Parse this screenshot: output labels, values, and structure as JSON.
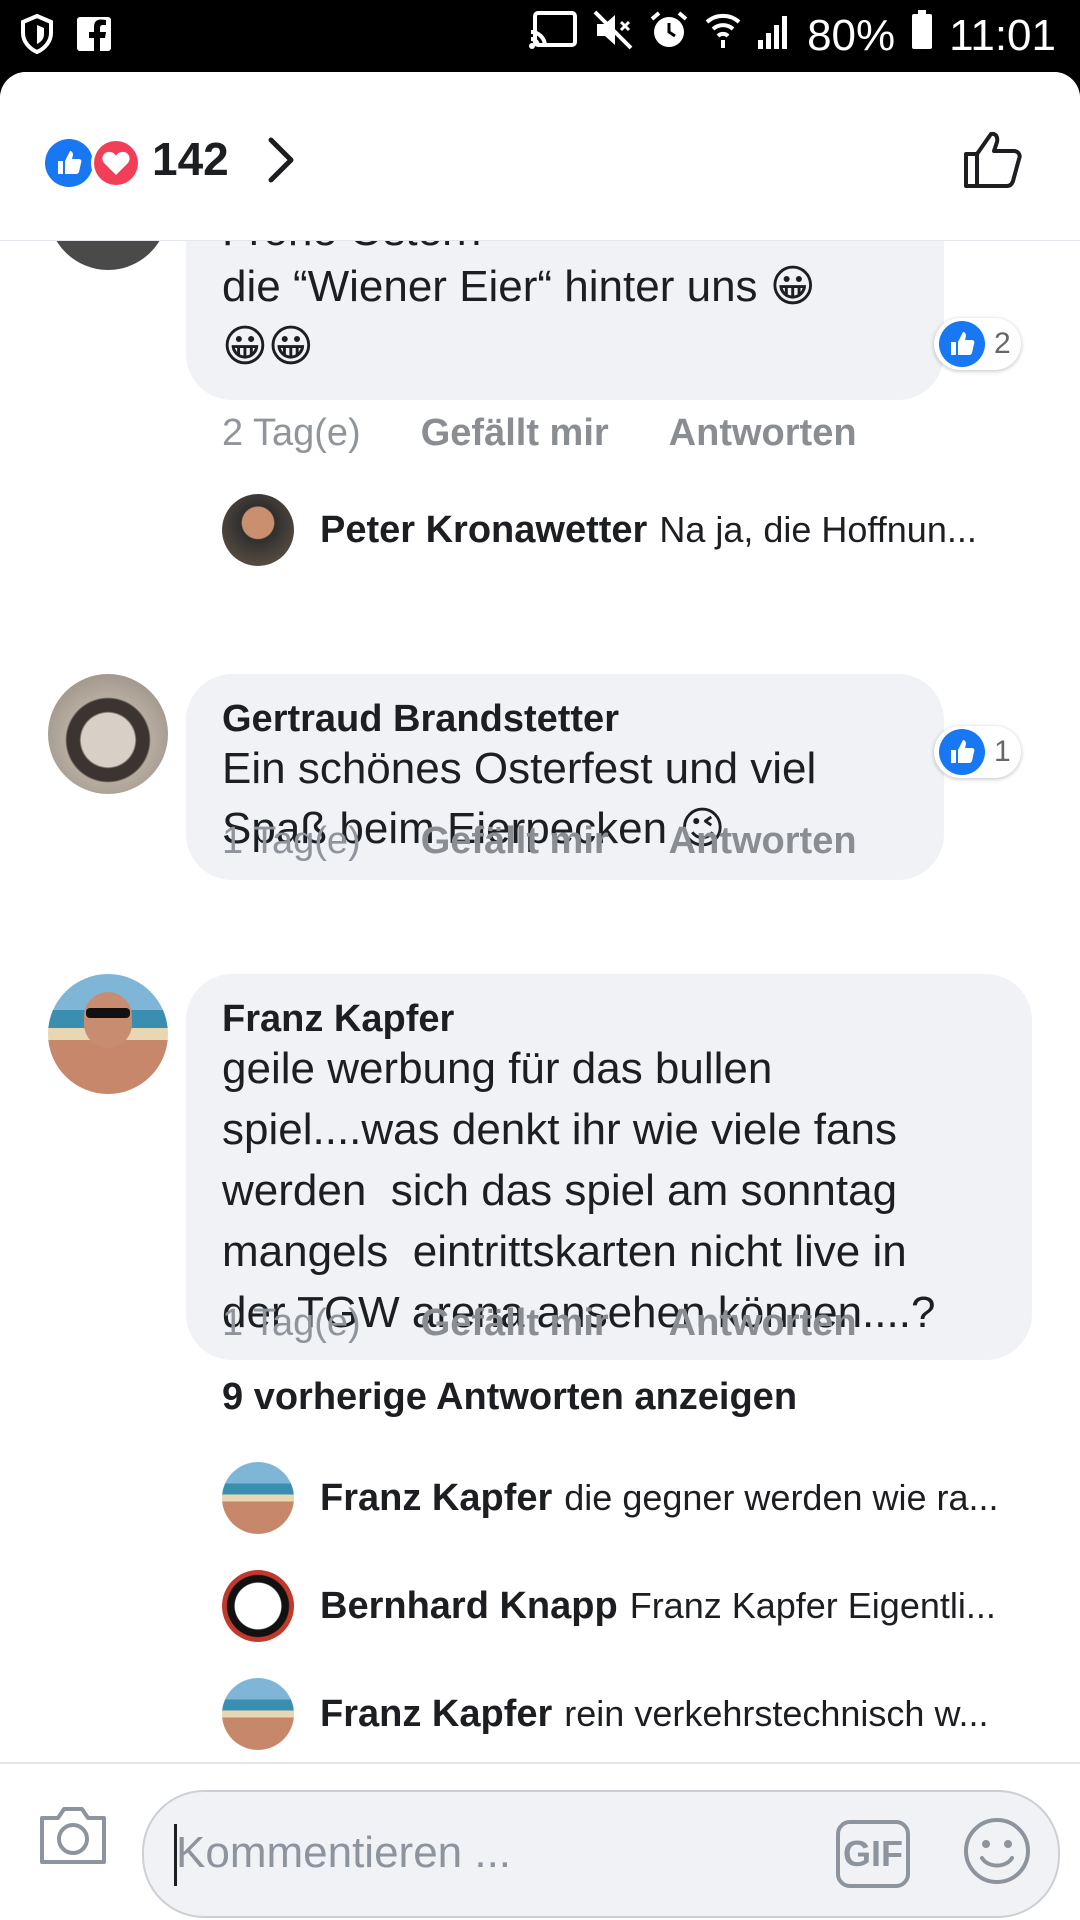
{
  "status_bar": {
    "battery": "80%",
    "time": "11:01"
  },
  "header": {
    "reaction_count": "142"
  },
  "comments": [
    {
      "text_line1": "Frohe Ostern",
      "text_line2": "die “Wiener Eier“ hinter uns",
      "emoji_line2": "😀",
      "emoji_line3": "😀😀",
      "like_count": "2",
      "time": "2 Tag(e)",
      "like_label": "Gefällt mir",
      "reply_label": "Antworten",
      "replies": [
        {
          "name": "Peter Kronawetter",
          "text": "Na ja, die Hoffnun..."
        }
      ]
    },
    {
      "name": "Gertraud Brandstetter",
      "text_line1": "Ein schönes Osterfest und viel",
      "text_line2": "Spaß beim Eierpecken",
      "emoji": "😉",
      "like_count": "1",
      "time": "1 Tag(e)",
      "like_label": "Gefällt mir",
      "reply_label": "Antworten"
    },
    {
      "name": "Franz Kapfer",
      "lines": [
        "geile werbung für das bullen",
        "spiel....was denkt ihr wie viele fans",
        "werden  sich das spiel am sonntag",
        "mangels  eintrittskarten nicht live in",
        "der TGW arena ansehen können....?"
      ],
      "time": "1 Tag(e)",
      "like_label": "Gefällt mir",
      "reply_label": "Antworten",
      "previous_replies_label": "9 vorherige Antworten anzeigen",
      "replies": [
        {
          "name": "Franz Kapfer",
          "text": "die gegner werden wie ra..."
        },
        {
          "name": "Bernhard Knapp",
          "text": "Franz Kapfer Eigentli..."
        },
        {
          "name": "Franz Kapfer",
          "text": "rein verkehrstechnisch w..."
        }
      ]
    }
  ],
  "composer": {
    "placeholder": "Kommentieren ...",
    "gif_label": "GIF"
  },
  "colors": {
    "like_blue": "#1877f2",
    "love_red": "#f33e58",
    "bubble_gray": "#f0f2f5"
  }
}
